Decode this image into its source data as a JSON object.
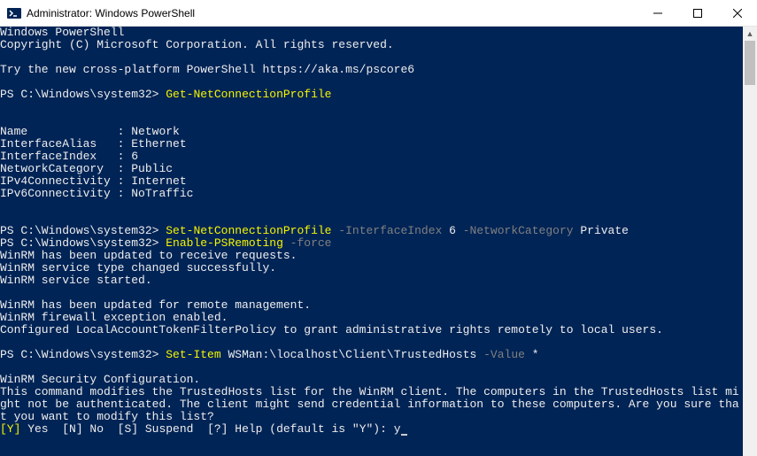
{
  "titlebar": {
    "title": "Administrator: Windows PowerShell"
  },
  "terminal": {
    "header1": "Windows PowerShell",
    "header2": "Copyright (C) Microsoft Corporation. All rights reserved.",
    "header3": "Try the new cross-platform PowerShell https://aka.ms/pscore6",
    "prompt": "PS C:\\Windows\\system32>",
    "cmd1": "Get-NetConnectionProfile",
    "profile": {
      "name_label": "Name             : ",
      "name_value": "Network",
      "alias_label": "InterfaceAlias   : ",
      "alias_value": "Ethernet",
      "index_label": "InterfaceIndex   : ",
      "index_value": "6",
      "netcat_label": "NetworkCategory  : ",
      "netcat_value": "Public",
      "ipv4_label": "IPv4Connectivity : ",
      "ipv4_value": "Internet",
      "ipv6_label": "IPv6Connectivity : ",
      "ipv6_value": "NoTraffic"
    },
    "cmd2": {
      "cmd": "Set-NetConnectionProfile",
      "p1": " -InterfaceIndex",
      "arg1": " 6",
      "p2": " -NetworkCategory",
      "arg2": " Private"
    },
    "cmd3": {
      "cmd": "Enable-PSRemoting",
      "p1": " -force"
    },
    "winrm1": "WinRM has been updated to receive requests.",
    "winrm2": "WinRM service type changed successfully.",
    "winrm3": "WinRM service started.",
    "winrm4": "WinRM has been updated for remote management.",
    "winrm5": "WinRM firewall exception enabled.",
    "winrm6": "Configured LocalAccountTokenFilterPolicy to grant administrative rights remotely to local users.",
    "cmd4": {
      "cmd": "Set-Item",
      "arg0": " WSMan:\\localhost\\Client\\TrustedHosts",
      "p1": " -Value",
      "arg1": " *"
    },
    "confirm_title": "WinRM Security Configuration.",
    "confirm_body": "This command modifies the TrustedHosts list for the WinRM client. The computers in the TrustedHosts list might not be authenticated. The client might send credential information to these computers. Are you sure that you want to modify this list?",
    "opt_y_key": "[Y]",
    "opt_y_lbl": " Yes  ",
    "opt_n_key": "[N]",
    "opt_n_lbl": " No  ",
    "opt_s_key": "[S]",
    "opt_s_lbl": " Suspend  ",
    "opt_h_key": "[?]",
    "opt_h_lbl": " Help (default is \"Y\"): ",
    "input": "y"
  }
}
